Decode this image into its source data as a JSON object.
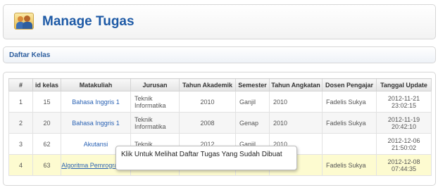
{
  "header": {
    "title": "Manage Tugas",
    "icon": "users-icon"
  },
  "section": {
    "title": "Daftar Kelas"
  },
  "table": {
    "columns": [
      "#",
      "id kelas",
      "Matakuliah",
      "Jurusan",
      "Tahun Akademik",
      "Semester",
      "Tahun Angkatan",
      "Dosen Pengajar",
      "Tanggal Update"
    ],
    "rows": [
      {
        "no": "1",
        "id": "15",
        "matakuliah": "Bahasa Inggris 1",
        "jurusan": "Teknik Informatika",
        "tahun_akademik": "2010",
        "semester": "Ganjil",
        "angkatan": "2010",
        "dosen": "Fadelis Sukya",
        "tanggal": "2012-11-21",
        "jam": "23:02:15"
      },
      {
        "no": "2",
        "id": "20",
        "matakuliah": "Bahasa Inggris 1",
        "jurusan": "Teknik Informatika",
        "tahun_akademik": "2008",
        "semester": "Genap",
        "angkatan": "2010",
        "dosen": "Fadelis Sukya",
        "tanggal": "2012-11-19",
        "jam": "20:42:10"
      },
      {
        "no": "3",
        "id": "62",
        "matakuliah": "Akutansi",
        "jurusan": "Teknik",
        "tahun_akademik": "2012",
        "semester": "Ganjil",
        "angkatan": "2010",
        "dosen": "",
        "tanggal": "2012-12-06",
        "jam": "21:50:02"
      },
      {
        "no": "4",
        "id": "63",
        "matakuliah": "Algoritma Pemrograman",
        "jurusan": "",
        "tahun_akademik": "",
        "semester": "",
        "angkatan": "",
        "dosen": "Fadelis Sukya",
        "tanggal": "2012-12-08",
        "jam": "07:44:35"
      }
    ]
  },
  "tooltip": {
    "text": "Klik Untuk Melihat Daftar Tugas Yang Sudah Dibuat"
  },
  "colors": {
    "title": "#1e5aa6",
    "link": "#2a62b4",
    "highlight_row": "#fdfbd0"
  }
}
